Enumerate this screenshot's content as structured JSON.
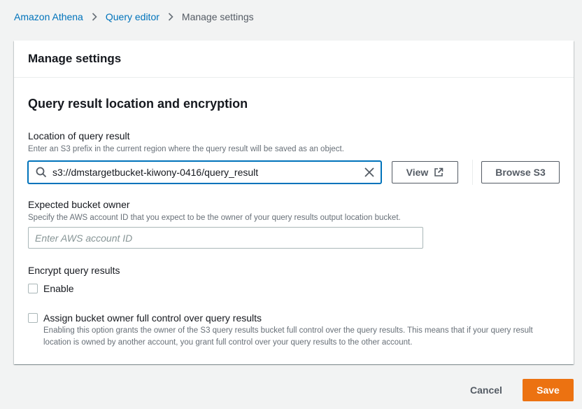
{
  "breadcrumb": {
    "items": [
      "Amazon Athena",
      "Query editor"
    ],
    "current": "Manage settings"
  },
  "panel": {
    "title": "Manage settings",
    "section_title": "Query result location and encryption",
    "location": {
      "label": "Location of query result",
      "description": "Enter an S3 prefix in the current region where the query result will be saved as an object.",
      "value": "s3://dmstargetbucket-kiwony-0416/query_result",
      "view_label": "View",
      "browse_label": "Browse S3"
    },
    "owner": {
      "label": "Expected bucket owner",
      "description": "Specify the AWS account ID that you expect to be the owner of your query results output location bucket.",
      "placeholder": "Enter AWS account ID"
    },
    "encrypt": {
      "label": "Encrypt query results",
      "checkbox_label": "Enable",
      "checked": false
    },
    "acl": {
      "checkbox_label": "Assign bucket owner full control over query results",
      "description": "Enabling this option grants the owner of the S3 query results bucket full control over the query results. This means that if your query result location is owned by another account, you grant full control over your query results to the other account.",
      "checked": false
    }
  },
  "footer": {
    "cancel_label": "Cancel",
    "save_label": "Save"
  },
  "colors": {
    "link": "#0073bb",
    "primary": "#ec7211",
    "background": "#f2f3f3"
  },
  "icons": [
    "chevron-right-icon",
    "search-icon",
    "clear-icon",
    "external-link-icon"
  ]
}
